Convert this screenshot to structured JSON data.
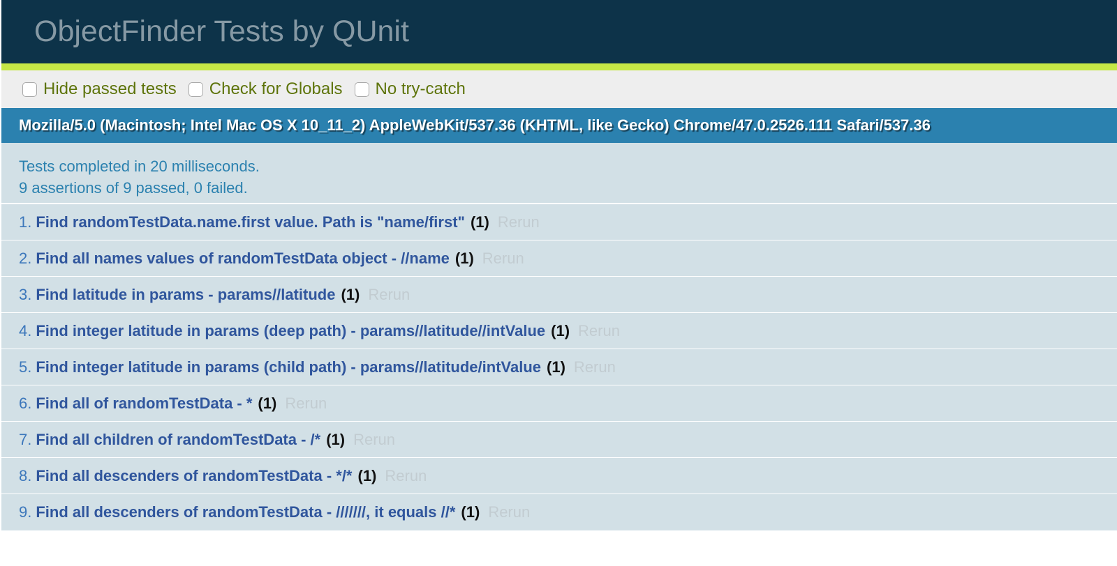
{
  "header": {
    "title": "ObjectFinder Tests by QUnit"
  },
  "colors": {
    "header_bg": "#0d3349",
    "banner_passed": "#c6e746",
    "toolbar_bg": "#eeeeee",
    "useragent_bg": "#2b81af",
    "test_bg": "#d2e0e6",
    "test_name": "#30569d",
    "rerun": "#c2ccd1"
  },
  "toolbar": {
    "options": [
      {
        "label": "Hide passed tests",
        "checked": false
      },
      {
        "label": "Check for Globals",
        "checked": false
      },
      {
        "label": "No try-catch",
        "checked": false
      }
    ]
  },
  "userAgent": "Mozilla/5.0 (Macintosh; Intel Mac OS X 10_11_2) AppleWebKit/537.36 (KHTML, like Gecko) Chrome/47.0.2526.111 Safari/537.36",
  "result": {
    "line1": "Tests completed in 20 milliseconds.",
    "line2": "9 assertions of 9 passed, 0 failed."
  },
  "tests": [
    {
      "num": "1.",
      "name": "Find randomTestData.name.first value. Path is \"name/first\"",
      "count": "(1)",
      "rerun": "Rerun"
    },
    {
      "num": "2.",
      "name": "Find all names values of randomTestData object - //name",
      "count": "(1)",
      "rerun": "Rerun"
    },
    {
      "num": "3.",
      "name": "Find latitude in params - params//latitude",
      "count": "(1)",
      "rerun": "Rerun"
    },
    {
      "num": "4.",
      "name": "Find integer latitude in params (deep path) - params//latitude//intValue",
      "count": "(1)",
      "rerun": "Rerun"
    },
    {
      "num": "5.",
      "name": "Find integer latitude in params (child path) - params//latitude/intValue",
      "count": "(1)",
      "rerun": "Rerun"
    },
    {
      "num": "6.",
      "name": "Find all of randomTestData - *",
      "count": "(1)",
      "rerun": "Rerun"
    },
    {
      "num": "7.",
      "name": "Find all children of randomTestData - /*",
      "count": "(1)",
      "rerun": "Rerun"
    },
    {
      "num": "8.",
      "name": "Find all descenders of randomTestData - */*",
      "count": "(1)",
      "rerun": "Rerun"
    },
    {
      "num": "9.",
      "name": "Find all descenders of randomTestData - ///////, it equals //*",
      "count": "(1)",
      "rerun": "Rerun"
    }
  ]
}
